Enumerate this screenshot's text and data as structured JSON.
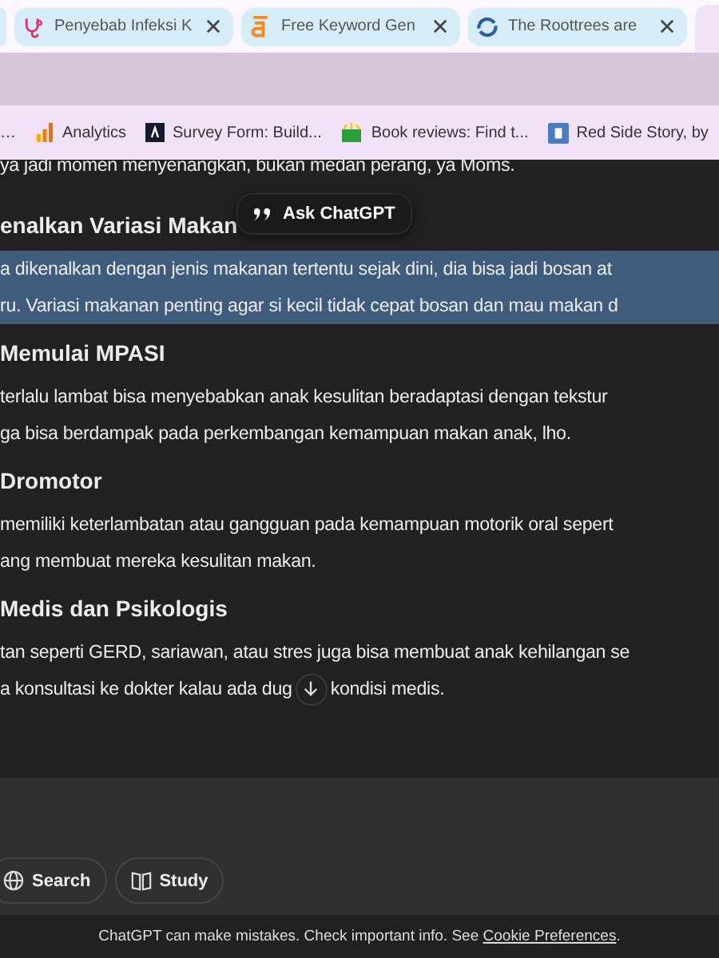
{
  "tabs": [
    {
      "title": "Penyebab Infeksi K"
    },
    {
      "title": "Free Keyword Gen"
    },
    {
      "title": "The Roottrees are"
    }
  ],
  "bookmarks": [
    {
      "label": "…"
    },
    {
      "label": "Analytics"
    },
    {
      "label": "Survey Form: Build..."
    },
    {
      "label": "Book reviews: Find t..."
    },
    {
      "label": "Red Side Story, by"
    }
  ],
  "article": [
    {
      "kind": "line",
      "text": "ya jadi momen menyenangkan, bukan medan perang, ya Moms.",
      "highlighted": false
    },
    {
      "kind": "heading",
      "text": "enalkan Variasi Makan"
    },
    {
      "kind": "line",
      "text": "a dikenalkan dengan jenis makanan tertentu sejak dini, dia bisa jadi bosan at",
      "highlighted": true
    },
    {
      "kind": "line",
      "text": "ru. Variasi makanan penting agar si kecil tidak cepat bosan dan mau makan d",
      "highlighted": true
    },
    {
      "kind": "heading",
      "text": "Memulai MPASI"
    },
    {
      "kind": "line",
      "text": "terlalu lambat bisa menyebabkan anak kesulitan beradaptasi dengan tekstur",
      "highlighted": false
    },
    {
      "kind": "line",
      "text": "ga bisa berdampak pada perkembangan kemampuan makan anak, lho.",
      "highlighted": false
    },
    {
      "kind": "heading",
      "text": "Dromotor"
    },
    {
      "kind": "line",
      "text": "memiliki keterlambatan atau gangguan pada kemampuan motorik oral sepert",
      "highlighted": false
    },
    {
      "kind": "line",
      "text": "ang membuat mereka kesulitan makan.",
      "highlighted": false
    },
    {
      "kind": "heading",
      "text": "Medis dan Psikologis"
    },
    {
      "kind": "line",
      "text": "tan seperti GERD, sariawan, atau stres juga bisa membuat anak kehilangan se",
      "highlighted": false
    },
    {
      "kind": "split",
      "before": "a konsultasi ke dokter kalau ada dug",
      "after": "kondisi medis."
    }
  ],
  "ask_popup": {
    "label": "Ask ChatGPT"
  },
  "composer": {
    "tools": [
      {
        "label": "Search"
      },
      {
        "label": "Study"
      }
    ]
  },
  "footer": {
    "text": "ChatGPT can make mistakes. Check important info. See ",
    "link": "Cookie Preferences",
    "end": "."
  }
}
